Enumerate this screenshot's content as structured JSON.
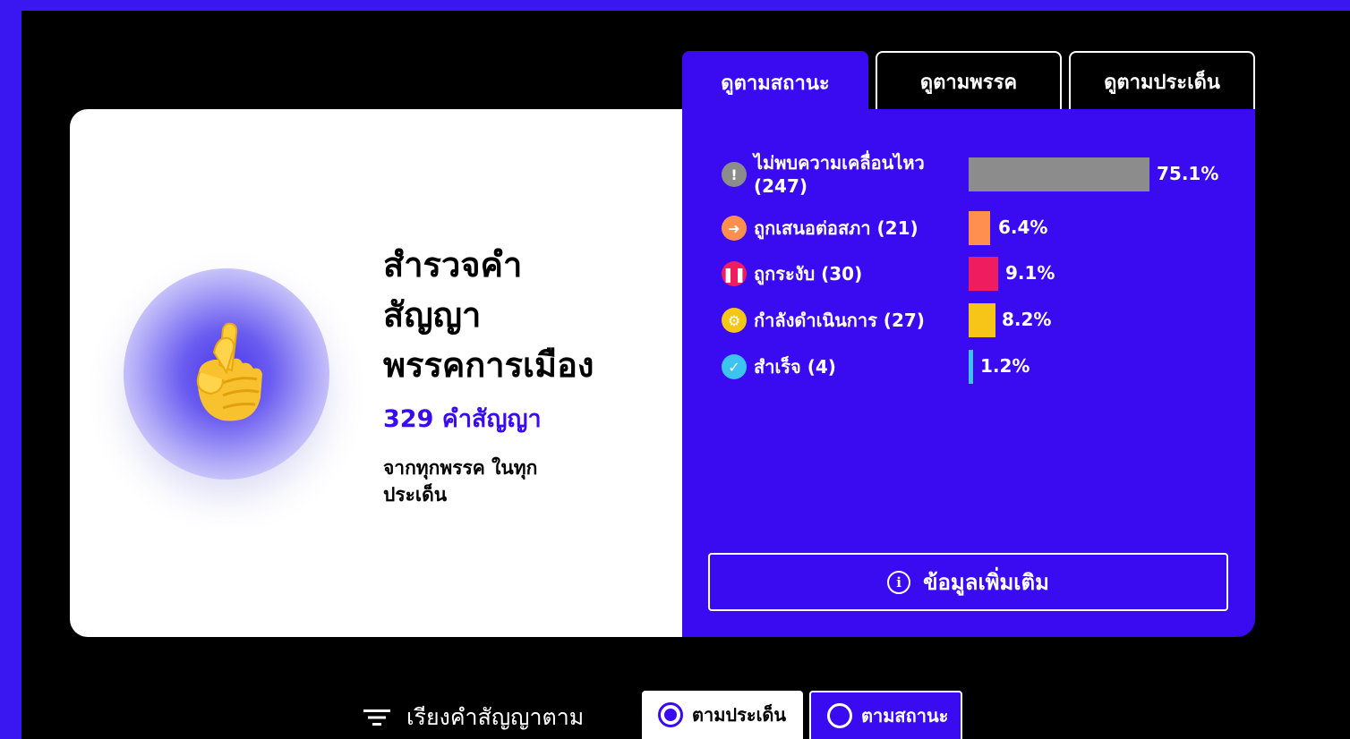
{
  "tabs": [
    {
      "label": "ดูตามสถานะ",
      "active": true
    },
    {
      "label": "ดูตามพรรค",
      "active": false
    },
    {
      "label": "ดูตามประเด็น",
      "active": false
    }
  ],
  "hero": {
    "icon": "crossed-fingers-emoji",
    "title_lines": [
      "สำรวจคำ",
      "สัญญา",
      "พรรคการเมือง"
    ],
    "count_label": "329 คำสัญญา",
    "subtitle": "จากทุกพรรค ในทุก ประเด็น"
  },
  "statuses": [
    {
      "label": "ไม่พบความเคลื่อนไหว (247)",
      "percent": "75.1%",
      "value": 75.1,
      "color": "#8c8c8c",
      "icon": "exclamation-icon"
    },
    {
      "label": "ถูกเสนอต่อสภา (21)",
      "percent": "6.4%",
      "value": 6.4,
      "color": "#ff8f4e",
      "icon": "arrow-right-icon"
    },
    {
      "label": "ถูกระงับ (30)",
      "percent": "9.1%",
      "value": 9.1,
      "color": "#ef1d60",
      "icon": "pause-icon"
    },
    {
      "label": "กำลังดำเนินการ (27)",
      "percent": "8.2%",
      "value": 8.2,
      "color": "#f5c518",
      "icon": "gear-icon"
    },
    {
      "label": "สำเร็จ (4)",
      "percent": "1.2%",
      "value": 1.2,
      "color": "#3cc3f0",
      "icon": "check-icon"
    }
  ],
  "more_info": {
    "label": "ข้อมูลเพิ่มเติม",
    "icon": "info-icon"
  },
  "sort": {
    "label": "เรียงคำสัญญาตาม",
    "icon": "filter-icon",
    "options": [
      {
        "label": "ตามประเด็น",
        "selected": true
      },
      {
        "label": "ตามสถานะ",
        "selected": false
      }
    ]
  },
  "colors": {
    "accent": "#3a0af0",
    "background": "#000000",
    "outer": "#3a16f0"
  }
}
